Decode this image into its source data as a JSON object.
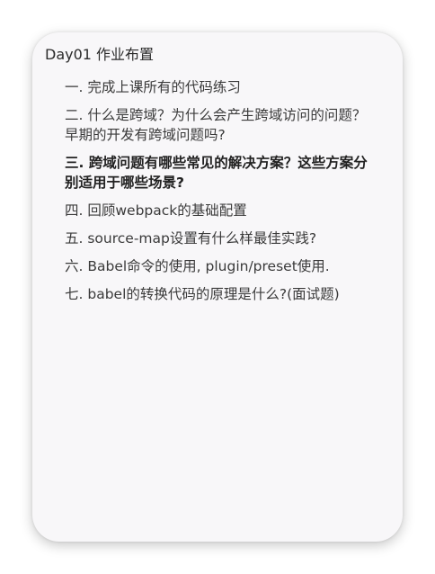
{
  "note": {
    "title": "Day01 作业布置",
    "items": [
      {
        "text": "一. 完成上课所有的代码练习",
        "emphasis": false
      },
      {
        "text": "二. 什么是跨域？为什么会产生跨域访问的问题？早期的开发有跨域问题吗?",
        "emphasis": false
      },
      {
        "text": "三. 跨域问题有哪些常见的解决方案？这些方案分别适用于哪些场景?",
        "emphasis": true
      },
      {
        "text": "四. 回顾webpack的基础配置",
        "emphasis": false
      },
      {
        "text": "五. source-map设置有什么样最佳实践?",
        "emphasis": false
      },
      {
        "text": "六. Babel命令的使用, plugin/preset使用.",
        "emphasis": false
      },
      {
        "text": "七. babel的转换代码的原理是什么?(面试题)",
        "emphasis": false
      }
    ]
  }
}
